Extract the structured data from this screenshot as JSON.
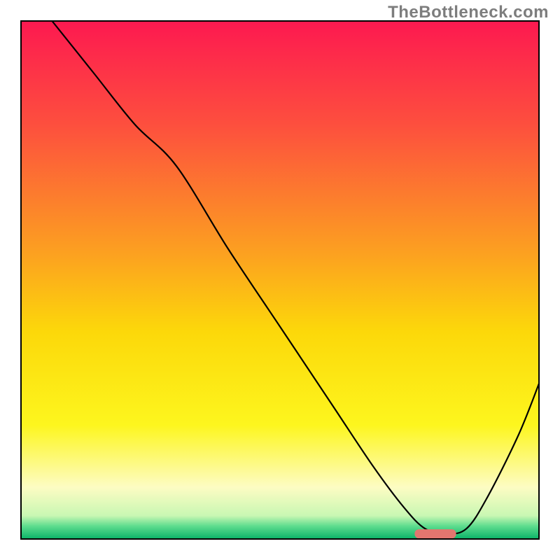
{
  "watermark": "TheBottleneck.com",
  "chart_data": {
    "type": "line",
    "title": "",
    "xlabel": "",
    "ylabel": "",
    "xlim": [
      0,
      100
    ],
    "ylim": [
      0,
      100
    ],
    "background": {
      "kind": "vertical_gradient",
      "description": "Red at top through orange, yellow, pale yellow, with thin green band at the bottom",
      "stops": [
        {
          "pos": 0.0,
          "color": "#fd1950"
        },
        {
          "pos": 0.2,
          "color": "#fd4f3e"
        },
        {
          "pos": 0.45,
          "color": "#fca120"
        },
        {
          "pos": 0.6,
          "color": "#fcd80a"
        },
        {
          "pos": 0.78,
          "color": "#fdf61e"
        },
        {
          "pos": 0.9,
          "color": "#fdfcc3"
        },
        {
          "pos": 0.955,
          "color": "#c9f7b3"
        },
        {
          "pos": 0.975,
          "color": "#5edc8e"
        },
        {
          "pos": 1.0,
          "color": "#0ab268"
        }
      ]
    },
    "series": [
      {
        "name": "bottleneck-curve",
        "stroke": "#000000",
        "x": [
          6,
          14,
          22,
          30,
          40,
          50,
          60,
          68,
          74,
          78,
          82,
          86,
          90,
          96,
          100
        ],
        "y": [
          100,
          90,
          80,
          72,
          56,
          41,
          26,
          14,
          6,
          2,
          1,
          2,
          8,
          20,
          30
        ]
      }
    ],
    "markers": [
      {
        "name": "optimal-range-marker",
        "shape": "rounded-bar",
        "x_start": 76,
        "x_end": 84,
        "y": 1,
        "color": "#e2766f"
      }
    ],
    "frame": {
      "color": "#000000",
      "width": 2
    }
  }
}
